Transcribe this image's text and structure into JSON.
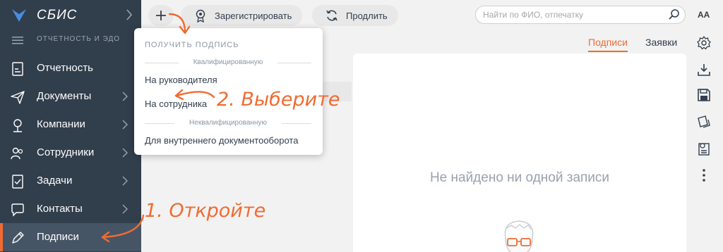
{
  "brand": {
    "name": "СБИС",
    "subtitle": "ОТЧЕТНОСТЬ И ЭДО"
  },
  "sidebar": {
    "items": [
      {
        "label": "Отчетность",
        "icon": "report-icon",
        "arrow": false
      },
      {
        "label": "Документы",
        "icon": "send-icon",
        "arrow": true
      },
      {
        "label": "Компании",
        "icon": "building-icon",
        "arrow": true
      },
      {
        "label": "Сотрудники",
        "icon": "users-icon",
        "arrow": true
      },
      {
        "label": "Задачи",
        "icon": "checklist-icon",
        "arrow": true
      },
      {
        "label": "Контакты",
        "icon": "chat-icon",
        "arrow": true
      },
      {
        "label": "Подписи",
        "icon": "pen-icon",
        "arrow": false,
        "active": true
      }
    ]
  },
  "toolbar": {
    "register_label": "Зарегистрировать",
    "renew_label": "Продлить"
  },
  "search": {
    "placeholder": "Найти по ФИО, отпечатку"
  },
  "rail": {
    "font_label": "AA"
  },
  "tabs": [
    {
      "label": "Подписи",
      "active": true
    },
    {
      "label": "Заявки",
      "active": false
    }
  ],
  "content": {
    "empty_text": "Не найдено ни одной записи"
  },
  "dropdown": {
    "title": "ПОЛУЧИТЬ ПОДПИСЬ",
    "section_qualified": "Квалифицированную",
    "item_director": "На руководителя",
    "item_employee": "На сотрудника",
    "section_unqualified": "Неквалифицированную",
    "item_internal": "Для внутреннего документооборота"
  },
  "annotations": {
    "step1": "1. Откройте",
    "step2": "2. Выберите"
  },
  "colors": {
    "sidebar_bg": "#313e4c",
    "accent": "#f06b32",
    "page_bg": "#f2f2f2"
  }
}
